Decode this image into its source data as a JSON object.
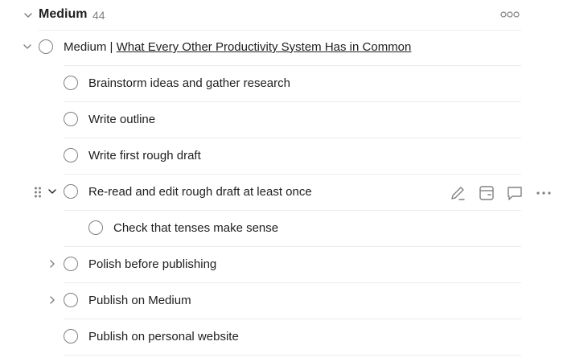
{
  "section": {
    "title": "Medium",
    "count": "44",
    "icons": {
      "collapse": "chevron-down-icon",
      "more": "more-horizontal-icon"
    }
  },
  "tasks": [
    {
      "prefix": "Medium | ",
      "link": "What Every Other Productivity System Has in Common",
      "expanded": true
    },
    {
      "text": "Brainstorm ideas and gather research"
    },
    {
      "text": "Write outline"
    },
    {
      "text": "Write first rough draft"
    },
    {
      "text": "Re-read and edit rough draft at least once",
      "expanded": true,
      "hovered": true
    },
    {
      "text": "Check that tenses make sense"
    },
    {
      "text": "Polish before publishing",
      "expanded": false
    },
    {
      "text": "Publish on Medium",
      "expanded": false
    },
    {
      "text": "Publish on personal website"
    }
  ],
  "hover_actions": [
    "edit-icon",
    "schedule-icon",
    "comment-icon",
    "more-horizontal-icon"
  ],
  "colors": {
    "text": "#202020",
    "muted": "#808080",
    "divider": "#ececec",
    "checkbox_border": "#808080"
  }
}
